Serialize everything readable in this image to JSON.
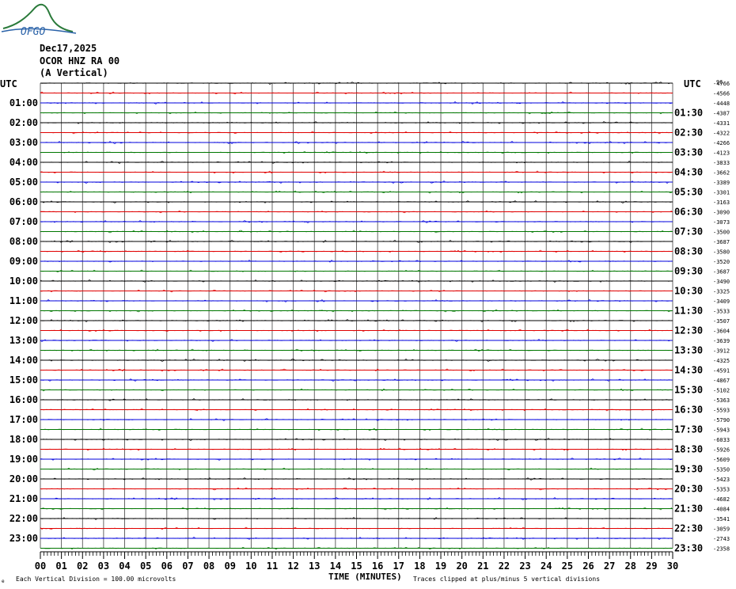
{
  "logo": {
    "text": "OFGO"
  },
  "header": {
    "date": "Dec17,2025",
    "station": "OCOR HNZ RA 00",
    "component": "(A Vertical)"
  },
  "axes": {
    "left_title": "UTC",
    "right_title": "UTC",
    "right_top_tiny": "96",
    "xlabel": "TIME (MINUTES)",
    "footer_left": "Each Vertical Division =  100.00 microvolts",
    "footer_right": "Traces clipped at plus/minus 5 vertical divisions",
    "footer_mark": "e"
  },
  "colors": {
    "black": "#000000",
    "red": "#e00000",
    "blue": "#0000dd",
    "green": "#007700",
    "grid_v": "#000000"
  },
  "chart_data": {
    "type": "line",
    "title": "",
    "x_range": [
      0,
      30
    ],
    "x_ticks": [
      "00",
      "01",
      "02",
      "03",
      "04",
      "05",
      "06",
      "07",
      "08",
      "09",
      "10",
      "11",
      "12",
      "13",
      "14",
      "15",
      "16",
      "17",
      "18",
      "19",
      "20",
      "21",
      "22",
      "23",
      "24",
      "25",
      "26",
      "27",
      "28",
      "29",
      "30"
    ],
    "trace_color_cycle": [
      "black",
      "red",
      "blue",
      "green"
    ],
    "left_labels": [
      "",
      "01:00",
      "02:00",
      "03:00",
      "04:00",
      "05:00",
      "06:00",
      "07:00",
      "08:00",
      "09:00",
      "10:00",
      "11:00",
      "12:00",
      "13:00",
      "14:00",
      "15:00",
      "16:00",
      "17:00",
      "18:00",
      "19:00",
      "20:00",
      "21:00",
      "22:00",
      "23:00"
    ],
    "right_labels": [
      "",
      "01:30",
      "02:30",
      "03:30",
      "04:30",
      "05:30",
      "06:30",
      "07:30",
      "08:30",
      "09:30",
      "10:30",
      "11:30",
      "12:30",
      "13:30",
      "14:30",
      "15:30",
      "16:30",
      "17:30",
      "18:30",
      "19:30",
      "20:30",
      "21:30",
      "22:30",
      "23:30"
    ],
    "offsets": [
      "-4766",
      "-4566",
      "-4448",
      "-4387",
      "-4331",
      "-4322",
      "-4266",
      "-4123",
      "-3833",
      "-3662",
      "-3389",
      "-3301",
      "-3163",
      "-3090",
      "-3073",
      "-3500",
      "-3687",
      "-3580",
      "-3520",
      "-3687",
      "-3490",
      "-3325",
      "-3409",
      "-3533",
      "-3507",
      "-3604",
      "-3639",
      "-3912",
      "-4325",
      "-4591",
      "-4867",
      "-5102",
      "-5363",
      "-5593",
      "-5790",
      "-5943",
      "-6033",
      "-5926",
      "-5609",
      "-5350",
      "-5423",
      "-5353",
      "-4682",
      "-4084",
      "-3541",
      "-3059",
      "-2743",
      "-2358"
    ]
  }
}
